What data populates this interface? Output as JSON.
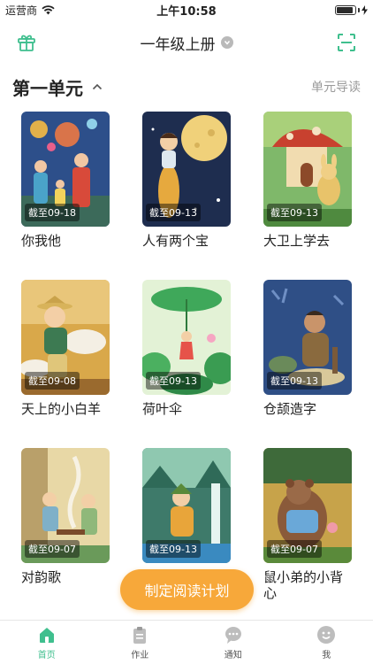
{
  "status_bar": {
    "carrier": "运营商",
    "time": "上午10:58",
    "battery_level": 0.9
  },
  "nav": {
    "title": "一年级上册"
  },
  "section": {
    "title": "第一单元",
    "guide": "单元导读"
  },
  "books": [
    {
      "title": "你我他",
      "deadline": "截至09-18"
    },
    {
      "title": "人有两个宝",
      "deadline": "截至09-13"
    },
    {
      "title": "大卫上学去",
      "deadline": "截至09-13"
    },
    {
      "title": "天上的小白羊",
      "deadline": "截至09-08"
    },
    {
      "title": "荷叶伞",
      "deadline": "截至09-13"
    },
    {
      "title": "仓颉造字",
      "deadline": "截至09-13"
    },
    {
      "title": "对韵歌",
      "deadline": "截至09-07"
    },
    {
      "title": "",
      "deadline": "截至09-13"
    },
    {
      "title": "鼠小弟的小背心",
      "deadline": "截至09-07"
    }
  ],
  "fab": {
    "label": "制定阅读计划"
  },
  "tabs": [
    {
      "label": "首页",
      "icon": "home-icon"
    },
    {
      "label": "作业",
      "icon": "clipboard-icon"
    },
    {
      "label": "通知",
      "icon": "chat-icon"
    },
    {
      "label": "我",
      "icon": "user-icon"
    }
  ],
  "colors": {
    "accent": "#3fbf8e",
    "fab": "#f7a83a"
  }
}
